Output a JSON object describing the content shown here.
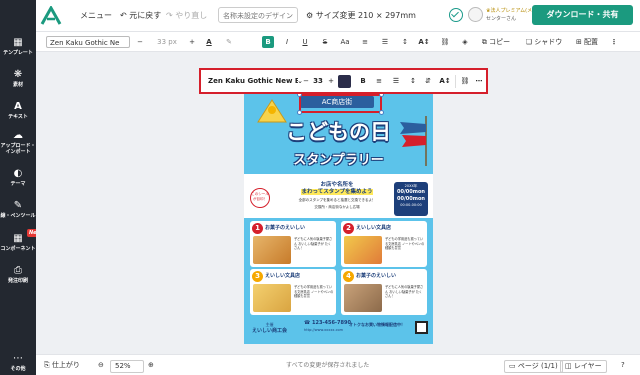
{
  "topbar": {
    "menu": "メニュー",
    "undo": "元に戻す",
    "redo": "やり直し",
    "doc_name": "名称未設定のデザイン",
    "size_change": "サイズ変更",
    "size_value": "210 × 297mm",
    "plan": "法人プレミアム(メンバー)",
    "user_name": "センターさん",
    "download": "ダウンロード・共有"
  },
  "sidebar": [
    {
      "icon": "▦",
      "label": "テンプレート"
    },
    {
      "icon": "❋",
      "label": "素材"
    },
    {
      "icon": "A",
      "label": "テキスト"
    },
    {
      "icon": "☁",
      "label": "アップロード・インポート"
    },
    {
      "icon": "◐",
      "label": "テーマ"
    },
    {
      "icon": "✎",
      "label": "線・ペンツール"
    },
    {
      "icon": "▦",
      "label": "コンポーネント"
    },
    {
      "icon": "⎙",
      "label": "発注印刷"
    },
    {
      "icon": "⋯",
      "label": "その他"
    }
  ],
  "sidebar_new_badge": "New",
  "toolbar2": {
    "font": "Zen Kaku Gothic Ne",
    "font_size": "33 px",
    "copy": "コピー",
    "shadow": "シャドウ",
    "align": "配置"
  },
  "floating_toolbar": {
    "font": "Zen Kaku Gothic New Bo",
    "font_size": "33",
    "color": "#2b2d4a"
  },
  "poster": {
    "ribbon": "AC商店街",
    "title1": "こどもの日",
    "title2": "スタンプラリー",
    "badge": "このシールが目印！",
    "headline_1": "お店や名所を",
    "headline_2": "まわってスタンプを集めよう",
    "body_1": "全部のスタンプを集めると抽選と交換できるよ！",
    "body_2": "交換所・商店街なかよし広場",
    "date_year": "20XX年",
    "date_line_1": "00/00mon",
    "date_line_2": "00/00mon",
    "date_time": "00:00-00:00",
    "cards": [
      {
        "num": "1",
        "name": "お菓子のえいしい",
        "desc": "子どもに人気の駄菓子屋さん おいしい駄菓子が たくさん！",
        "color": "#d51f2b"
      },
      {
        "num": "2",
        "name": "えいしい文具店",
        "desc": "子どもの学用品も揃っている文房具店 ノートやペンの種類も豊富",
        "color": "#d51f2b"
      },
      {
        "num": "3",
        "name": "えいしい文具店",
        "desc": "子どもの学用品も揃っている文房具店 ノートやペンの種類も豊富",
        "color": "#f6a800"
      },
      {
        "num": "4",
        "name": "お菓子のえいしい",
        "desc": "子どもに人気の駄菓子屋さん おいしい駄菓子が たくさん！",
        "color": "#f6a800"
      }
    ],
    "footer_org_1": "主催",
    "footer_org_2": "えいしい商工会",
    "footer_phone": "123-456-7890",
    "footer_url": "http://www.xxxxx.com",
    "footer_mid": "オトクなお買い物情報配信中！"
  },
  "bottombar": {
    "finish": "仕上がり",
    "zoom": "52%",
    "status": "すべての変更が保存されました",
    "page": "ページ",
    "page_count": "(1/1)",
    "layer": "レイヤー"
  }
}
